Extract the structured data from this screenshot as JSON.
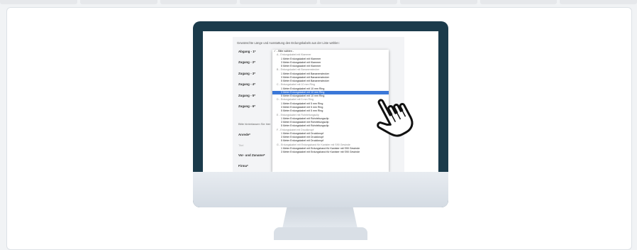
{
  "form": {
    "header": "Gewünschte Länge und Ausstattung des Erdungskabels aus der Liste wählen:",
    "rows": [
      {
        "label": "Abgang - 1*"
      },
      {
        "label": "Zugang - 2*"
      },
      {
        "label": "Zugang - 3*"
      },
      {
        "label": "Zugang - 4*"
      },
      {
        "label": "Zugang - 5*"
      },
      {
        "label": "Zugang - 6*"
      }
    ],
    "contact_hint": "Bitte hinterlassen Sie hier",
    "salutation_label": "Anrede*",
    "title_placeholder": "Titel",
    "name_label": "Vor- und Zuname*",
    "company_label": "Firma*"
  },
  "dropdown": {
    "items": [
      {
        "text": "✓ - Bitte wählen -",
        "kind": "first"
      },
      {
        "text": "A - Erdungskabel mit Klammer",
        "kind": "group"
      },
      {
        "text": "1 Meter Erdungskabel mit Klammer",
        "kind": "option"
      },
      {
        "text": "3 Meter Erdungskabel mit Klammer",
        "kind": "option"
      },
      {
        "text": "5 Meter Erdungskabel mit Klammer",
        "kind": "option"
      },
      {
        "text": "B - Erdungskabel mit Bananenstecker",
        "kind": "group"
      },
      {
        "text": "1 Meter Erdungskabel mit Bananenstecker",
        "kind": "option"
      },
      {
        "text": "3 Meter Erdungskabel mit Bananenstecker",
        "kind": "option"
      },
      {
        "text": "5 Meter Erdungskabel mit Bananenstecker",
        "kind": "option"
      },
      {
        "text": "C - Erdungskabel mit 10 mm Ring",
        "kind": "group"
      },
      {
        "text": "1 Meter Erdungskabel mit 10 mm Ring",
        "kind": "option"
      },
      {
        "text": "3 Meter Erdungskabel mit 10 mm Ring",
        "kind": "selected"
      },
      {
        "text": "5 Meter Erdungskabel mit 10 mm Ring",
        "kind": "option"
      },
      {
        "text": "D - Erdungskabel mit 5 mm Ring",
        "kind": "group"
      },
      {
        "text": "1 Meter Erdungskabel mit 5 mm Ring",
        "kind": "option"
      },
      {
        "text": "3 Meter Erdungskabel mit 5 mm Ring",
        "kind": "option"
      },
      {
        "text": "5 Meter Erdungskabel mit 5 mm Ring",
        "kind": "option"
      },
      {
        "text": "E - Erdungskabel mit Rohrleitungsclip",
        "kind": "group"
      },
      {
        "text": "1 Meter Erdungskabel mit Rohrleitungsclip",
        "kind": "option"
      },
      {
        "text": "3 Meter Erdungskabel mit Rohrleitungsclip",
        "kind": "option"
      },
      {
        "text": "5 Meter Erdungskabel mit Rohrleitungsclip",
        "kind": "option"
      },
      {
        "text": "F - Erdungskabel mit Druckknopf",
        "kind": "group"
      },
      {
        "text": "1 Meter Erdungskabel mit Druckknopf",
        "kind": "option"
      },
      {
        "text": "3 Meter Erdungskabel mit Druckknopf",
        "kind": "option"
      },
      {
        "text": "5 Meter Erdungskabel mit Druckknopf",
        "kind": "option"
      },
      {
        "text": "G - Erdungskabel mit Erdungsband für Kanister mit S90 Gewinde",
        "kind": "group"
      },
      {
        "text": "1 Meter Erdungskabel mit Erdungsband für Kanister mit S90 Gewinde",
        "kind": "option"
      },
      {
        "text": "3 Meter Erdungskabel mit Erdungsband für Kanister mit S90 Gewinde",
        "kind": "option"
      }
    ]
  },
  "icons": {
    "cursor": "hand-pointer-icon"
  },
  "colors": {
    "monitor_bezel": "#1b3b4b",
    "selection": "#3b78d8"
  }
}
